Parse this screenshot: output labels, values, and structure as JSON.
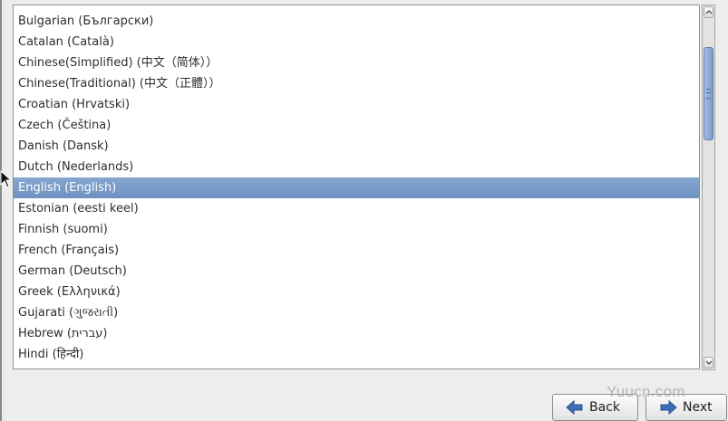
{
  "languages": {
    "items": [
      "Bulgarian (Български)",
      "Catalan (Català)",
      "Chinese(Simplified) (中文（简体））",
      "Chinese(Traditional) (中文（正體））",
      "Croatian (Hrvatski)",
      "Czech (Čeština)",
      "Danish (Dansk)",
      "Dutch (Nederlands)",
      "English (English)",
      "Estonian (eesti keel)",
      "Finnish (suomi)",
      "French (Français)",
      "German (Deutsch)",
      "Greek (Ελληνικά)",
      "Gujarati (ગુજરાતી)",
      "Hebrew (עברית)",
      "Hindi (हिन्दी)"
    ],
    "selected": "English (English)"
  },
  "buttons": {
    "back_label": "Back",
    "next_label": "Next",
    "back_icon": "arrow-left-icon",
    "next_icon": "arrow-right-icon"
  },
  "watermark": "Yuucn.com",
  "colors": {
    "selection": "#7897c6",
    "arrow_icon": "#3d6fb8"
  }
}
